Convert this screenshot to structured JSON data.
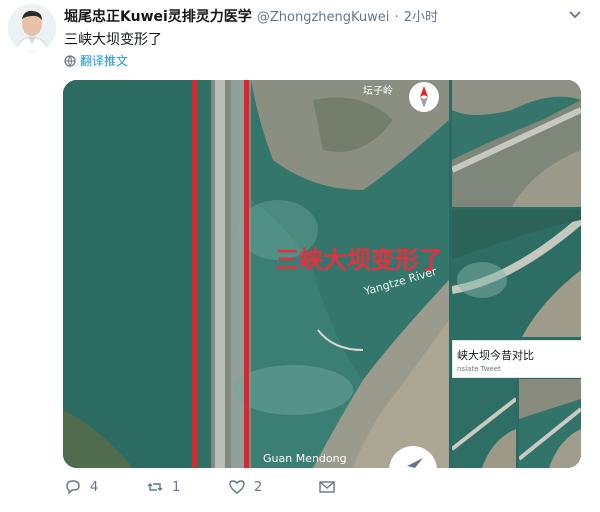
{
  "author": {
    "display_name": "堀尾忠正Kuwei灵排灵力医学",
    "handle": "@ZhongzhengKuwei",
    "separator": "·",
    "time": "2小时"
  },
  "tweet": {
    "text": "三峡大坝变形了",
    "translate_label": "翻译推文"
  },
  "media": {
    "main_overlay_text": "三峡大坝变形了",
    "river_label": "Yangtze River",
    "bottom_label": "Guan Mendong",
    "top_label": "坛子岭",
    "inset_caption": "峡大坝今昔对比",
    "inset_sub": "nslate Tweet"
  },
  "actions": {
    "replies": "4",
    "retweets": "1",
    "likes": "2"
  },
  "colors": {
    "red_line": "#e0242f",
    "water": "#2e6f68",
    "accent_link": "#1b95e0"
  },
  "icons": [
    "globe-icon",
    "chevron-down-icon",
    "reply-icon",
    "retweet-icon",
    "like-icon",
    "share-icon",
    "compass-icon"
  ]
}
